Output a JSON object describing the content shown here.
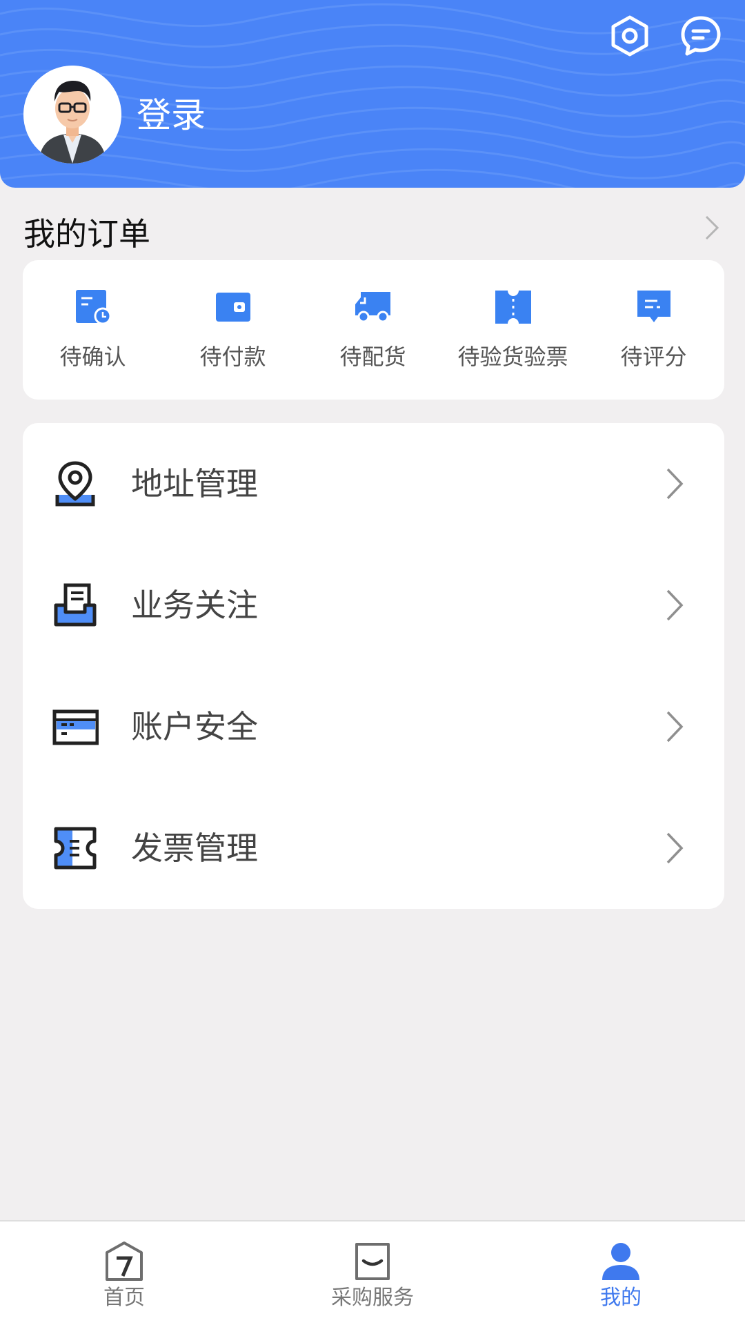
{
  "colors": {
    "header_bg": "#4a84f7",
    "page_bg": "#f1eff0",
    "accent": "#3f79ee",
    "icon_blue": "#3a82f2"
  },
  "header": {
    "login_label": "登录",
    "icons": [
      "settings-icon",
      "message-icon"
    ]
  },
  "orders": {
    "title": "我的订单",
    "items": [
      {
        "label": "待确认",
        "icon": "pending-confirm-icon"
      },
      {
        "label": "待付款",
        "icon": "wallet-icon"
      },
      {
        "label": "待配货",
        "icon": "truck-icon"
      },
      {
        "label": "待验货验票",
        "icon": "ticket-icon"
      },
      {
        "label": "待评分",
        "icon": "comment-icon"
      }
    ]
  },
  "menu": {
    "items": [
      {
        "label": "地址管理",
        "icon": "location-pin-icon"
      },
      {
        "label": "业务关注",
        "icon": "document-tray-icon"
      },
      {
        "label": "账户安全",
        "icon": "card-icon"
      },
      {
        "label": "发票管理",
        "icon": "invoice-icon"
      }
    ]
  },
  "nav": {
    "items": [
      {
        "label": "首页",
        "icon": "home-icon",
        "active": false
      },
      {
        "label": "采购服务",
        "icon": "shopping-bag-icon",
        "active": false
      },
      {
        "label": "我的",
        "icon": "user-icon",
        "active": true
      }
    ]
  }
}
